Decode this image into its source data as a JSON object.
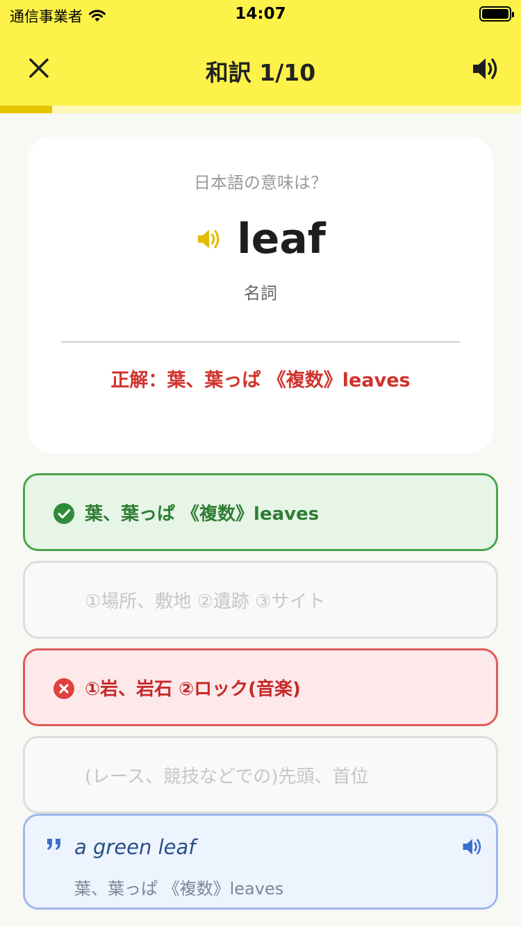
{
  "status_bar": {
    "carrier": "通信事業者",
    "time": "14:07"
  },
  "header": {
    "title": "和訳  1/10",
    "close_icon": "close-icon",
    "sound_icon": "speaker-icon"
  },
  "progress": {
    "current": 1,
    "total": 10,
    "fraction": 0.1
  },
  "question": {
    "prompt": "日本語の意味は？",
    "word": "leaf",
    "part_of_speech": "名詞",
    "answer_text": "正解：葉、葉っぱ 《複数》leaves"
  },
  "options": [
    {
      "label": "葉、葉っぱ 《複数》leaves",
      "state": "correct",
      "icon": "check-circle-icon"
    },
    {
      "label": "①場所、敷地 ②遺跡 ③サイト",
      "state": "disabled"
    },
    {
      "label": "①岩、岩石 ②ロック(音楽)",
      "state": "wrong",
      "icon": "x-circle-icon"
    },
    {
      "label": "(レース、競技などでの)先頭、首位",
      "state": "disabled"
    }
  ],
  "example": {
    "sentence": "a green leaf",
    "translation": "葉、葉っぱ 《複数》leaves",
    "quote_icon": "quote-icon",
    "sound_icon": "speaker-icon"
  },
  "colors": {
    "header_bg": "#fdf24a",
    "progress_fill": "#e6c400",
    "correct_green": "#4aa549",
    "wrong_red": "#e05a56",
    "answer_red": "#d0322c",
    "example_blue": "#9eb8ec"
  }
}
